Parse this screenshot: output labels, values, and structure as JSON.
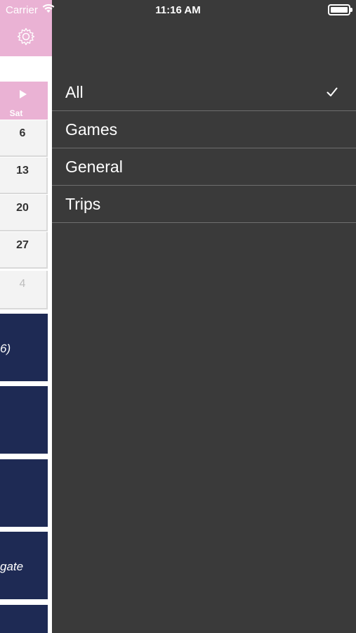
{
  "status_bar": {
    "carrier": "Carrier",
    "time": "11:16 AM"
  },
  "calendar": {
    "weekday_label": "Sat",
    "days": [
      {
        "number": "6",
        "muted": false
      },
      {
        "number": "13",
        "muted": false
      },
      {
        "number": "20",
        "muted": false
      },
      {
        "number": "27",
        "muted": false
      },
      {
        "number": "4",
        "muted": true
      }
    ],
    "events": [
      {
        "text": "6)"
      },
      {
        "text": ""
      },
      {
        "text": ""
      },
      {
        "text": "gate"
      },
      {
        "text": ""
      }
    ]
  },
  "menu": {
    "items": [
      {
        "label": "All",
        "selected": true
      },
      {
        "label": "Games",
        "selected": false
      },
      {
        "label": "General",
        "selected": false
      },
      {
        "label": "Trips",
        "selected": false
      }
    ]
  },
  "colors": {
    "accent_pink": "#eab2d4",
    "event_navy": "#1e2a54",
    "menu_bg": "#3a3a3a"
  }
}
